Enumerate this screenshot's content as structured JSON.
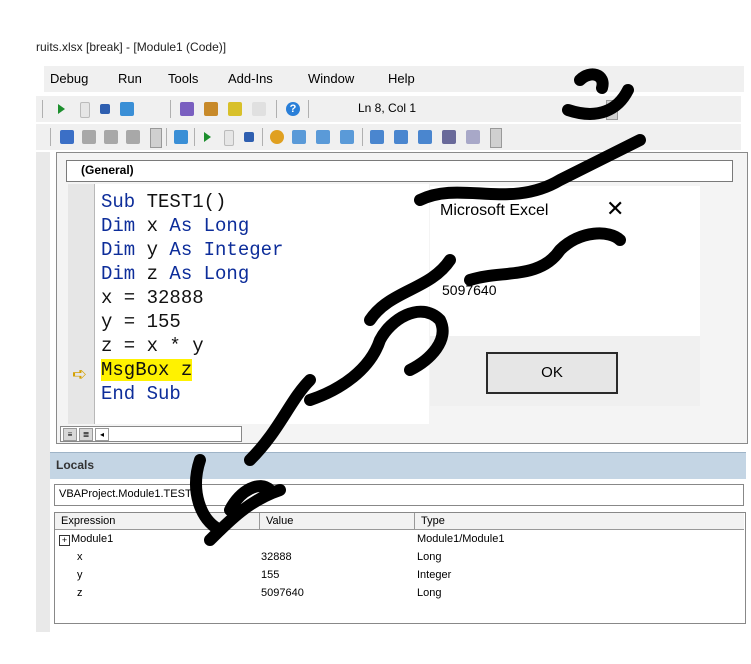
{
  "window": {
    "title": "ruits.xlsx [break] - [Module1 (Code)]"
  },
  "menu": [
    {
      "label": "Debug",
      "accel": "D"
    },
    {
      "label": "Run",
      "accel": "R"
    },
    {
      "label": "Tools",
      "accel": "T"
    },
    {
      "label": "Add-Ins",
      "accel": "A"
    },
    {
      "label": "Window",
      "accel": "W"
    },
    {
      "label": "Help",
      "accel": "H"
    }
  ],
  "toolbar": {
    "position": "Ln 8, Col 1"
  },
  "code_window": {
    "object_box": "(General)",
    "lines": [
      {
        "kw1": "Sub ",
        "txt": "TEST1()"
      },
      {
        "kw1": "Dim ",
        "txt": "x ",
        "kw2": "As Long"
      },
      {
        "kw1": "Dim ",
        "txt": "y ",
        "kw2": "As Integer"
      },
      {
        "kw1": "Dim ",
        "txt": "z ",
        "kw2": "As Long"
      },
      {
        "txt": "x = 32888"
      },
      {
        "txt": "y = 155"
      },
      {
        "txt": "z = x * y"
      },
      {
        "hl": "MsgBox z"
      },
      {
        "kw1": "End Sub"
      }
    ]
  },
  "msgbox": {
    "title": "Microsoft Excel",
    "close": "✕",
    "message": "5097640",
    "ok_label": "OK"
  },
  "locals": {
    "title": "Locals",
    "context": "VBAProject.Module1.TEST1",
    "columns": [
      "Expression",
      "Value",
      "Type"
    ],
    "rows": [
      {
        "expr": "Module1",
        "value": "",
        "type": "Module1/Module1"
      },
      {
        "expr": "x",
        "value": "32888",
        "type": "Long"
      },
      {
        "expr": "y",
        "value": "155",
        "type": "Integer"
      },
      {
        "expr": "z",
        "value": "5097640",
        "type": "Long"
      }
    ]
  },
  "colors": {
    "keyword": "#0d2d9a",
    "highlight": "#fff200",
    "locals_bar": "#c4d5e4"
  }
}
